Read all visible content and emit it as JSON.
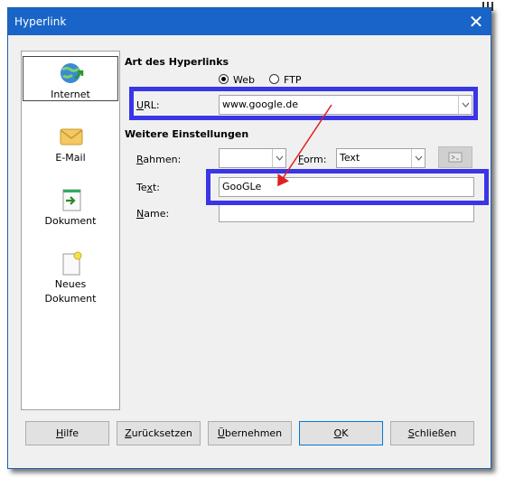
{
  "window": {
    "title": "Hyperlink"
  },
  "sidebar": {
    "items": [
      {
        "label": "Internet",
        "icon": "globe-link-icon",
        "selected": true
      },
      {
        "label": "E-Mail",
        "icon": "envelope-icon"
      },
      {
        "label": "Dokument",
        "icon": "document-link-icon"
      },
      {
        "label": "Neues\nDokument",
        "icon": "new-document-icon"
      }
    ]
  },
  "type_section": {
    "title": "Art des Hyperlinks",
    "radio_web": "Web",
    "radio_ftp": "FTP",
    "selected": "Web",
    "url_label": "URL:",
    "url_value": "www.google.de"
  },
  "settings_section": {
    "title": "Weitere Einstellungen",
    "frame_label": "Rahmen:",
    "frame_value": "",
    "form_label": "Form:",
    "form_value": "Text",
    "text_label": "Text:",
    "text_value": "GooGLe",
    "name_label": "Name:",
    "name_value": ""
  },
  "buttons": {
    "help": "Hilfe",
    "reset": "Zurücksetzen",
    "apply": "Übernehmen",
    "ok": "OK",
    "close": "Schließen"
  },
  "colors": {
    "titlebar": "#1964c8",
    "highlight_box": "#3a35e6",
    "annotation_arrow": "#e02020"
  }
}
